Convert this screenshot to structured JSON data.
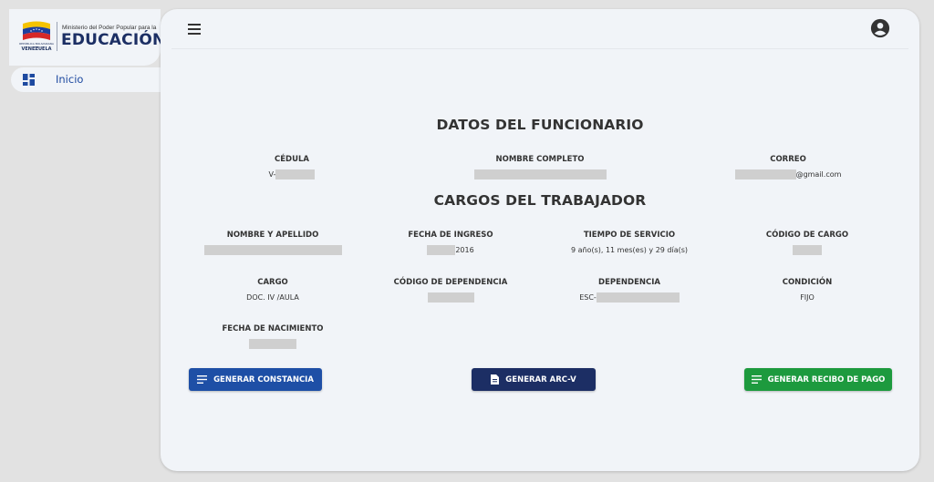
{
  "logo": {
    "ministry": "Ministerio del Poder Popular para la",
    "main": "EDUCACIÓN",
    "country": "VENEZUELA",
    "republic": "REPÚBLICA BOLIVARIANA DE"
  },
  "nav": {
    "items": [
      {
        "label": "Inicio",
        "icon": "dashboard-icon"
      }
    ]
  },
  "topbar": {
    "menu_icon": "hamburger-menu-icon",
    "account_icon": "account-circle-icon"
  },
  "funcionario": {
    "title": "DATOS DEL FUNCIONARIO",
    "cedula_label": "CÉDULA",
    "cedula_prefix": "V-",
    "nombre_label": "NOMBRE COMPLETO",
    "correo_label": "CORREO",
    "correo_suffix": "@gmail.com"
  },
  "cargos": {
    "title": "CARGOS DEL TRABAJADOR",
    "nombre_label": "NOMBRE Y APELLIDO",
    "fecha_ingreso_label": "FECHA DE INGRESO",
    "fecha_ingreso_suffix": "2016",
    "tiempo_label": "TIEMPO DE SERVICIO",
    "tiempo_value": "9 año(s), 11 mes(es) y 29 día(s)",
    "codigo_cargo_label": "CÓDIGO DE CARGO",
    "cargo_label": "CARGO",
    "cargo_value": "DOC. IV /AULA",
    "codigo_dep_label": "CÓDIGO DE DEPENDENCIA",
    "dependencia_label": "DEPENDENCIA",
    "dependencia_prefix": "ESC-",
    "condicion_label": "CONDICIÓN",
    "condicion_value": "FIJO",
    "nacimiento_label": "FECHA DE NACIMIENTO"
  },
  "buttons": {
    "constancia": "GENERAR CONSTANCIA",
    "arcv": "GENERAR ARC-V",
    "recibo": "GENERAR RECIBO DE PAGO"
  },
  "colors": {
    "constancia": "#1e4fa6",
    "arcv": "#1c2e64",
    "recibo": "#1d9a3e",
    "accent": "#1e4aa0"
  }
}
